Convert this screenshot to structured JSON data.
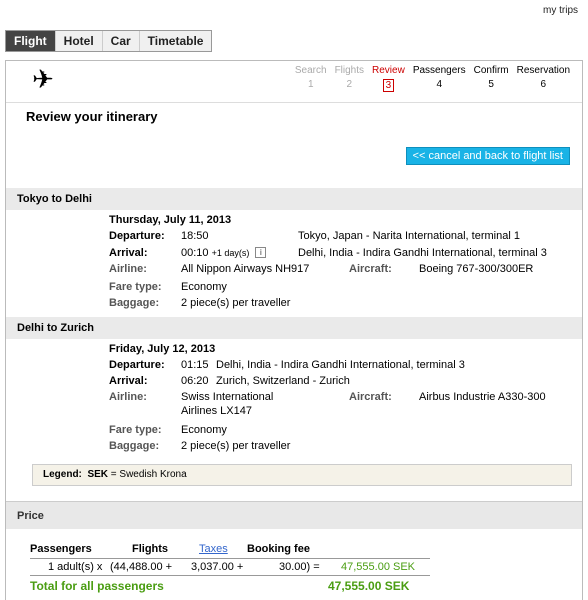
{
  "header": {
    "my_trips": "my trips"
  },
  "tabs": [
    {
      "label": "Flight",
      "active": true
    },
    {
      "label": "Hotel",
      "active": false
    },
    {
      "label": "Car",
      "active": false
    },
    {
      "label": "Timetable",
      "active": false
    }
  ],
  "steps": [
    {
      "label": "Search",
      "num": "1",
      "state": "done"
    },
    {
      "label": "Flights",
      "num": "2",
      "state": "done"
    },
    {
      "label": "Review",
      "num": "3",
      "state": "active"
    },
    {
      "label": "Passengers",
      "num": "4",
      "state": "todo"
    },
    {
      "label": "Confirm",
      "num": "5",
      "state": "todo"
    },
    {
      "label": "Reservation",
      "num": "6",
      "state": "todo"
    }
  ],
  "page_title": "Review your itinerary",
  "back_button": "<< cancel and back to flight list",
  "legs": [
    {
      "route": "Tokyo to Delhi",
      "date": "Thursday, July 11, 2013",
      "departure_label": "Departure:",
      "departure_time": "18:50",
      "departure_place": "Tokyo, Japan - Narita International, terminal 1",
      "arrival_label": "Arrival:",
      "arrival_time": "00:10",
      "arrival_plus": "+1 day(s)",
      "arrival_place": "Delhi, India - Indira Gandhi International, terminal 3",
      "airline_label": "Airline:",
      "airline": "All Nippon Airways NH917",
      "aircraft_label": "Aircraft:",
      "aircraft": "Boeing 767-300/300ER",
      "fare_label": "Fare type:",
      "fare": "Economy",
      "baggage_label": "Baggage:",
      "baggage": "2 piece(s) per traveller"
    },
    {
      "route": "Delhi to Zurich",
      "date": "Friday, July 12, 2013",
      "departure_label": "Departure:",
      "departure_time": "01:15",
      "departure_place": "Delhi, India - Indira Gandhi International, terminal 3",
      "arrival_label": "Arrival:",
      "arrival_time": "06:20",
      "arrival_place": "Zurich, Switzerland - Zurich",
      "airline_label": "Airline:",
      "airline_line1": "Swiss International",
      "airline_line2": "Airlines LX147",
      "aircraft_label": "Aircraft:",
      "aircraft": "Airbus Industrie A330-300",
      "fare_label": "Fare type:",
      "fare": "Economy",
      "baggage_label": "Baggage:",
      "baggage": "2 piece(s) per traveller"
    }
  ],
  "legend": {
    "label": "Legend:",
    "code": "SEK",
    "desc": "= Swedish Krona"
  },
  "price": {
    "heading": "Price",
    "col_passengers": "Passengers",
    "col_flights": "Flights",
    "col_taxes": "Taxes",
    "col_booking": "Booking fee",
    "row_pax": "1 adult(s) x",
    "row_flights": "(44,488.00 +",
    "row_taxes": "3,037.00 +",
    "row_booking": "30.00) =",
    "row_total": "47,555.00 SEK",
    "total_label": "Total for all passengers",
    "total_value": "47,555.00 SEK"
  },
  "colors": {
    "accent": "#19b3e6",
    "active_step": "#cc0000",
    "total_green": "#4a9d12"
  }
}
